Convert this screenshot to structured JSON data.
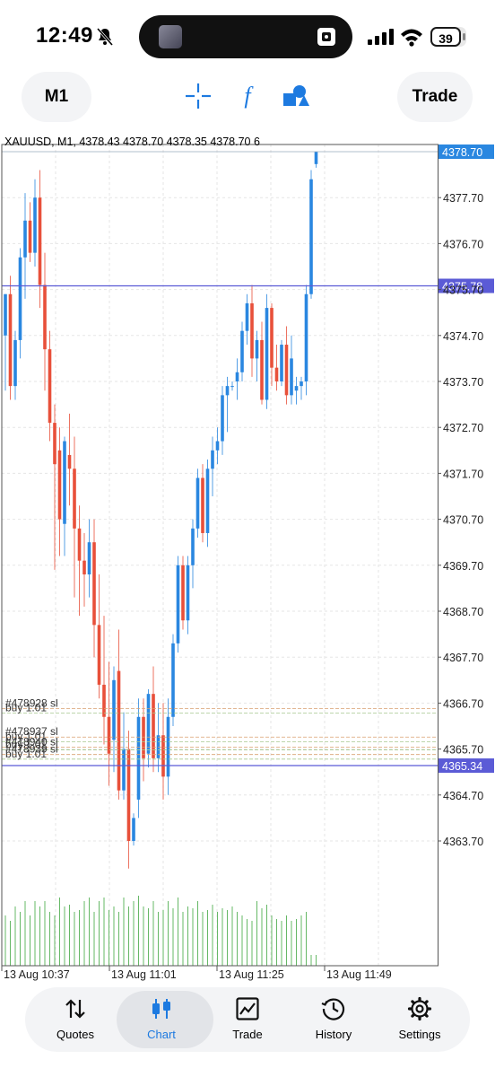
{
  "status_bar": {
    "time": "12:49",
    "battery": "39"
  },
  "toolbar": {
    "timeframe": "M1",
    "trade_label": "Trade",
    "tools": [
      "crosshair-icon",
      "function-icon",
      "shapes-icon"
    ]
  },
  "chart_header": {
    "text": "XAUUSD, M1, 4378.43 4378.70 4378.35 4378.70 6"
  },
  "chart_data": {
    "type": "candlestick",
    "symbol": "XAUUSD",
    "timeframe": "M1",
    "ohlc_header": {
      "open": 4378.43,
      "high": 4378.7,
      "low": 4378.35,
      "close": 4378.7,
      "volume": 6
    },
    "y_ticks": [
      "4377.70",
      "4376.70",
      "4375.70",
      "4374.70",
      "4373.70",
      "4372.70",
      "4371.70",
      "4370.70",
      "4369.70",
      "4368.70",
      "4367.70",
      "4366.70",
      "4365.70",
      "4364.70",
      "4363.70"
    ],
    "x_ticks": [
      "13 Aug 10:37",
      "13 Aug 11:01",
      "13 Aug 11:25",
      "13 Aug 11:49"
    ],
    "price_lines": [
      {
        "value": 4378.7,
        "label": "4378.70",
        "kind": "current"
      },
      {
        "value": 4375.78,
        "label": "4375.78",
        "kind": "level"
      },
      {
        "value": 4365.34,
        "label": "4365.34",
        "kind": "level"
      }
    ],
    "order_labels": [
      {
        "price": 4366.62,
        "text": "#478928 sl"
      },
      {
        "price": 4366.52,
        "text": "buy 1.01"
      },
      {
        "price": 4366.0,
        "text": "#478937 sl"
      },
      {
        "price": 4365.9,
        "text": "buy 1.01"
      },
      {
        "price": 4365.78,
        "text": "#478940 sl"
      },
      {
        "price": 4365.72,
        "text": "buy 1.01"
      },
      {
        "price": 4365.62,
        "text": "#478939 sl"
      },
      {
        "price": 4365.52,
        "text": "buy 1.01"
      }
    ],
    "colors": {
      "up": "#2a87e0",
      "down": "#e8503a",
      "volume": "#66b866",
      "level_line": "#5b5bd6",
      "grid": "#e6e6e6"
    },
    "candles": [
      [
        4374.7,
        4375.6,
        4373.5,
        4375.6
      ],
      [
        4375.6,
        4376.0,
        4373.3,
        4373.6
      ],
      [
        4373.6,
        4374.8,
        4373.3,
        4374.6
      ],
      [
        4374.6,
        4376.6,
        4374.2,
        4376.4
      ],
      [
        4376.4,
        4377.8,
        4375.5,
        4377.2
      ],
      [
        4377.2,
        4377.6,
        4376.3,
        4376.5
      ],
      [
        4376.5,
        4378.1,
        4376.2,
        4377.7
      ],
      [
        4377.7,
        4378.3,
        4375.3,
        4375.8
      ],
      [
        4375.8,
        4376.5,
        4373.5,
        4374.4
      ],
      [
        4374.4,
        4374.8,
        4372.4,
        4372.8
      ],
      [
        4372.8,
        4373.2,
        4369.6,
        4371.9
      ],
      [
        4372.2,
        4372.7,
        4369.9,
        4370.7
      ],
      [
        4370.6,
        4372.5,
        4369.9,
        4372.4
      ],
      [
        4372.1,
        4373.0,
        4371.0,
        4371.8
      ],
      [
        4371.8,
        4372.5,
        4369.0,
        4370.5
      ],
      [
        4370.5,
        4371.0,
        4368.6,
        4369.8
      ],
      [
        4369.8,
        4370.4,
        4368.8,
        4369.5
      ],
      [
        4369.5,
        4370.7,
        4369.0,
        4370.2
      ],
      [
        4370.2,
        4370.7,
        4367.7,
        4368.4
      ],
      [
        4368.4,
        4369.5,
        4366.8,
        4367.1
      ],
      [
        4367.1,
        4368.6,
        4365.8,
        4366.4
      ],
      [
        4366.4,
        4367.6,
        4364.9,
        4365.6
      ],
      [
        4365.9,
        4367.5,
        4365.2,
        4367.2
      ],
      [
        4367.4,
        4368.3,
        4364.6,
        4364.8
      ],
      [
        4364.8,
        4366.5,
        4364.6,
        4365.7
      ],
      [
        4365.7,
        4366.1,
        4363.1,
        4363.7
      ],
      [
        4363.7,
        4364.3,
        4363.6,
        4364.2
      ],
      [
        4364.6,
        4366.8,
        4364.2,
        4366.4
      ],
      [
        4366.4,
        4366.8,
        4365.0,
        4365.5
      ],
      [
        4365.6,
        4367.0,
        4365.3,
        4366.9
      ],
      [
        4366.9,
        4367.5,
        4365.2,
        4365.5
      ],
      [
        4365.5,
        4366.7,
        4365.2,
        4366.0
      ],
      [
        4366.0,
        4366.7,
        4364.6,
        4365.1
      ],
      [
        4365.1,
        4366.8,
        4364.7,
        4366.4
      ],
      [
        4366.4,
        4368.2,
        4366.2,
        4368.0
      ],
      [
        4368.0,
        4369.9,
        4367.8,
        4369.7
      ],
      [
        4369.7,
        4369.9,
        4368.3,
        4368.5
      ],
      [
        4368.5,
        4369.9,
        4368.2,
        4369.7
      ],
      [
        4369.7,
        4370.7,
        4369.2,
        4370.5
      ],
      [
        4370.5,
        4371.8,
        4370.3,
        4371.6
      ],
      [
        4371.6,
        4371.9,
        4370.2,
        4370.4
      ],
      [
        4370.4,
        4372.0,
        4370.1,
        4371.8
      ],
      [
        4371.8,
        4372.5,
        4371.2,
        4372.2
      ],
      [
        4372.2,
        4372.7,
        4371.9,
        4372.4
      ],
      [
        4372.4,
        4373.6,
        4372.1,
        4373.4
      ],
      [
        4373.4,
        4373.8,
        4372.6,
        4373.6
      ],
      [
        4373.6,
        4373.7,
        4373.5,
        4373.6
      ],
      [
        4373.7,
        4374.2,
        4373.3,
        4373.9
      ],
      [
        4373.9,
        4375.0,
        4373.7,
        4374.8
      ],
      [
        4374.8,
        4375.6,
        4374.5,
        4375.4
      ],
      [
        4375.4,
        4375.8,
        4373.8,
        4374.2
      ],
      [
        4374.2,
        4374.8,
        4373.7,
        4374.6
      ],
      [
        4374.6,
        4375.0,
        4373.2,
        4373.3
      ],
      [
        4373.3,
        4375.6,
        4373.1,
        4375.3
      ],
      [
        4375.3,
        4375.4,
        4373.6,
        4374.0
      ],
      [
        4374.0,
        4374.5,
        4373.5,
        4373.7
      ],
      [
        4373.7,
        4374.6,
        4373.6,
        4374.5
      ],
      [
        4374.5,
        4374.9,
        4373.2,
        4373.4
      ],
      [
        4373.4,
        4374.7,
        4373.2,
        4374.2
      ],
      [
        4373.5,
        4373.8,
        4373.2,
        4373.6
      ],
      [
        4373.6,
        4373.8,
        4373.3,
        4373.7
      ],
      [
        4373.7,
        4375.8,
        4373.4,
        4375.6
      ],
      [
        4375.6,
        4378.3,
        4375.5,
        4378.1
      ],
      [
        4378.43,
        4378.7,
        4378.35,
        4378.7
      ]
    ],
    "volumes": [
      28,
      25,
      33,
      30,
      36,
      28,
      36,
      33,
      36,
      30,
      28,
      38,
      33,
      34,
      30,
      31,
      36,
      38,
      30,
      36,
      38,
      31,
      33,
      30,
      38,
      33,
      36,
      39,
      33,
      32,
      36,
      30,
      31,
      36,
      32,
      38,
      30,
      33,
      32,
      36,
      30,
      31,
      34,
      30,
      32,
      31,
      33,
      30,
      28,
      26,
      25,
      36,
      32,
      34,
      28,
      26,
      25,
      28,
      25,
      26,
      28,
      30,
      6,
      6
    ]
  },
  "bottom_nav": [
    {
      "label": "Quotes",
      "icon": "quotes-arrows-icon",
      "active": false
    },
    {
      "label": "Chart",
      "icon": "candles-icon",
      "active": true
    },
    {
      "label": "Trade",
      "icon": "trade-chart-icon",
      "active": false
    },
    {
      "label": "History",
      "icon": "history-clock-icon",
      "active": false
    },
    {
      "label": "Settings",
      "icon": "settings-gear-icon",
      "active": false
    }
  ]
}
